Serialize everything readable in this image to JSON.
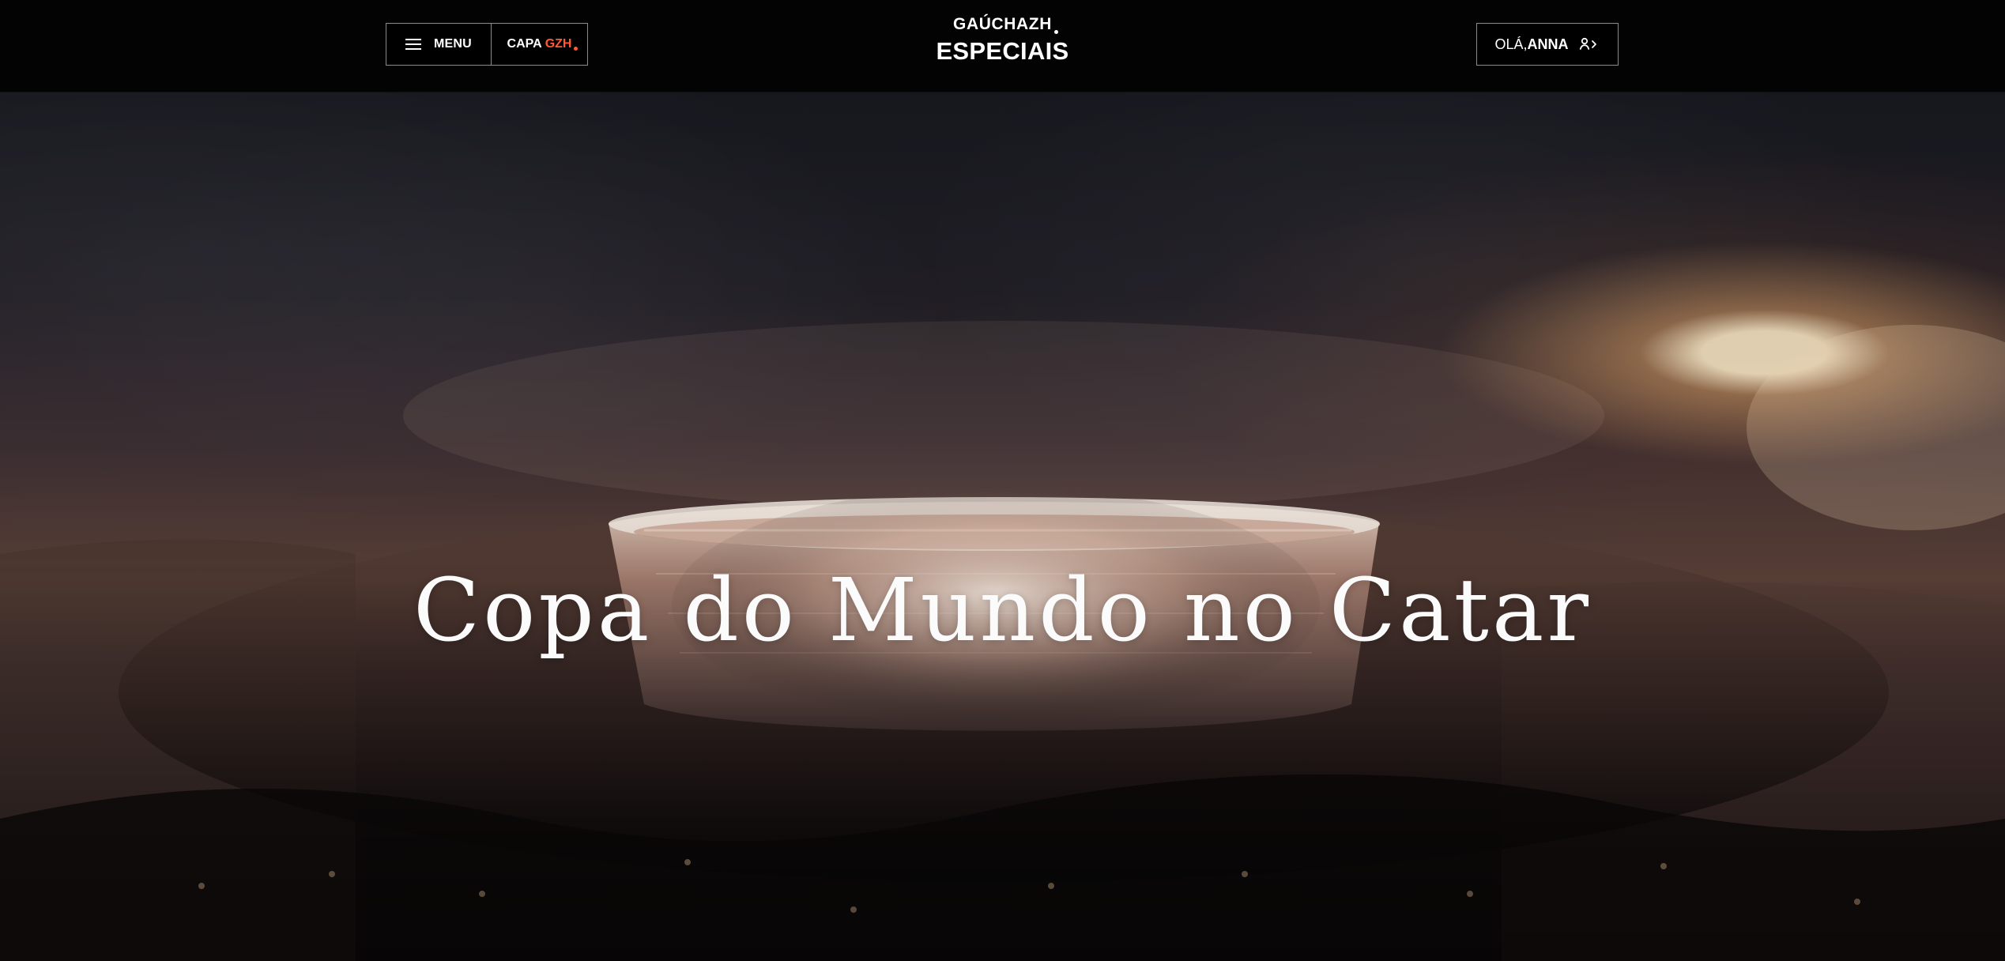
{
  "header": {
    "menu_label": "MENU",
    "capa_label": "CAPA",
    "capa_brand": "GZH",
    "brand_top": "GAÚCHAZH",
    "brand_bottom": "ESPECIAIS",
    "greeting": "OLÁ,",
    "user_name": "ANNA"
  },
  "hero": {
    "title": "Copa do Mundo no Catar"
  },
  "icons": {
    "menu": "hamburger-icon",
    "user": "user-icon",
    "chevron": "chevron-right-icon"
  },
  "colors": {
    "topbar_bg": "#030303",
    "accent": "#ff5a36",
    "text": "#ffffff"
  }
}
